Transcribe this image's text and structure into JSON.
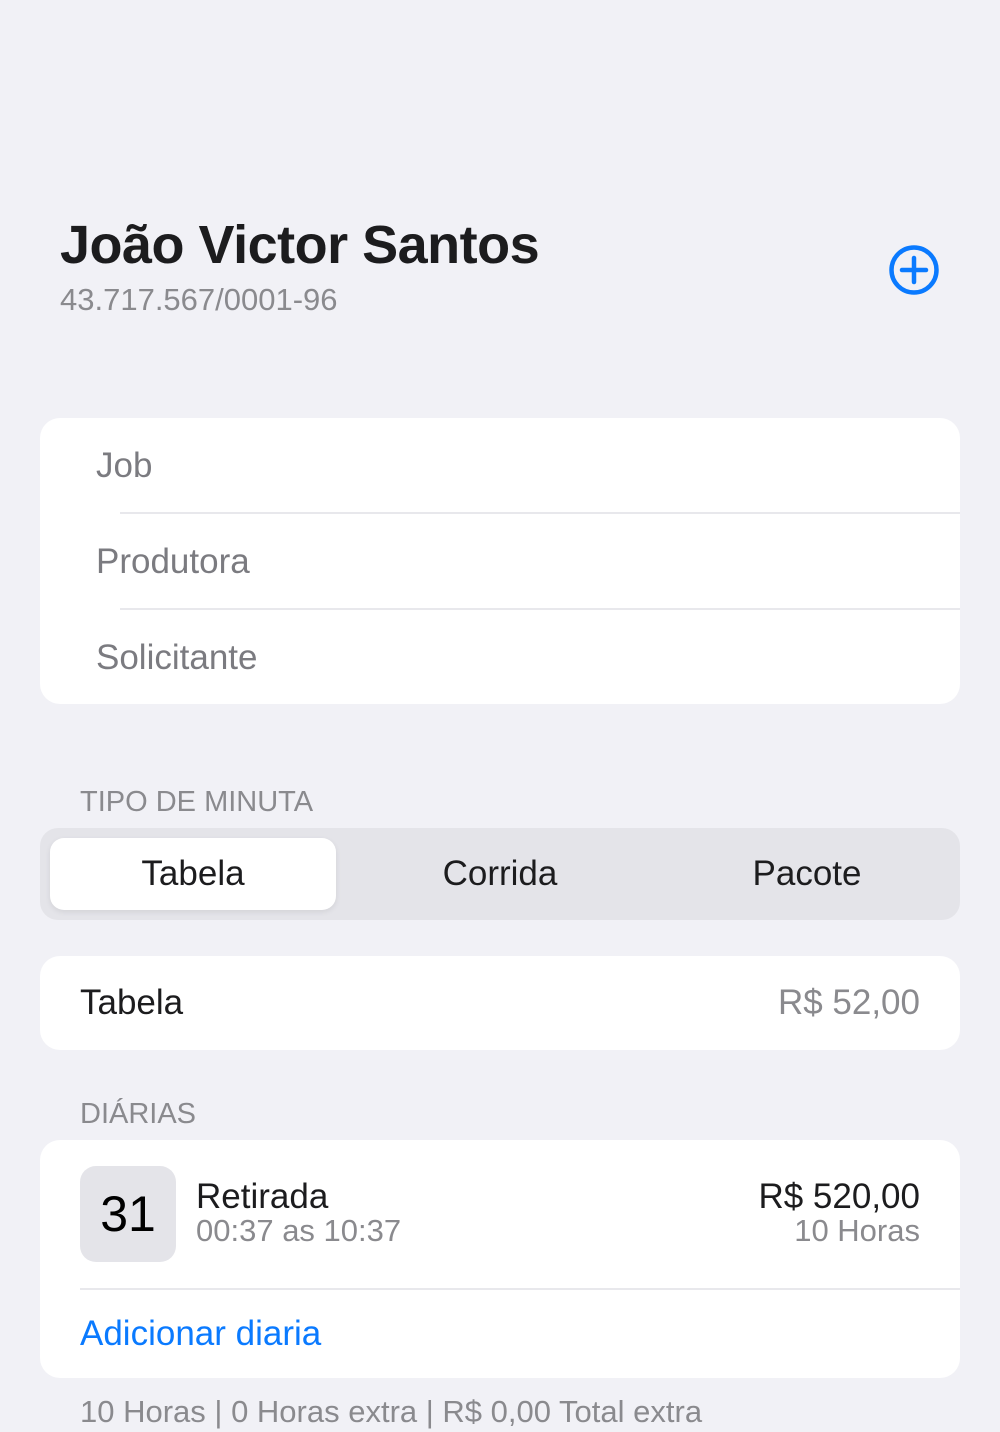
{
  "header": {
    "title": "João Victor Santos",
    "subtitle": "43.717.567/0001-96"
  },
  "form": {
    "job_placeholder": "Job",
    "job_value": "",
    "produtora_placeholder": "Produtora",
    "produtora_value": "",
    "solicitante_placeholder": "Solicitante",
    "solicitante_value": ""
  },
  "tipo_minuta": {
    "section_label": "TIPO DE MINUTA",
    "options": [
      "Tabela",
      "Corrida",
      "Pacote"
    ],
    "selected": "Tabela"
  },
  "tabela_row": {
    "label": "Tabela",
    "value": "R$ 52,00"
  },
  "diarias": {
    "section_label": "DIÁRIAS",
    "items": [
      {
        "day": "31",
        "title": "Retirada",
        "time": "00:37 as 10:37",
        "price": "R$ 520,00",
        "hours": "10 Horas"
      }
    ],
    "add_label": "Adicionar diaria"
  },
  "summary": "10 Horas | 0 Horas extra | R$ 0,00 Total extra",
  "colors": {
    "accent": "#0a7aff",
    "background": "#f1f1f6",
    "card": "#ffffff",
    "secondary_text": "#8a8a8e"
  },
  "icons": {
    "add": "plus-circle-icon"
  }
}
